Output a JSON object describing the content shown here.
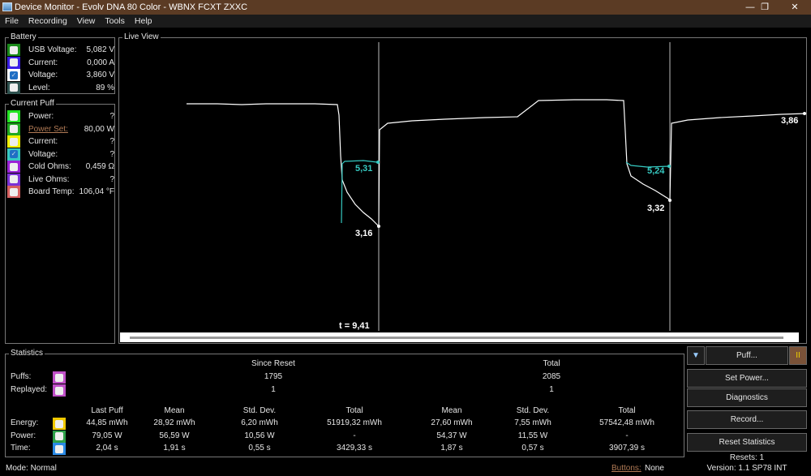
{
  "window": {
    "title": "Device Monitor - Evolv DNA 80 Color - WBNX FCXT ZXXC",
    "minimize": "—",
    "maximize": "❐",
    "close": "✕"
  },
  "menu": [
    "File",
    "Recording",
    "View",
    "Tools",
    "Help"
  ],
  "battery": {
    "label": "Battery",
    "rows": [
      {
        "label": "USB Voltage:",
        "value": "5,082 V",
        "color": "#1a8a1a",
        "checked": false
      },
      {
        "label": "Current:",
        "value": "0,000 A",
        "color": "#3a1ee6",
        "checked": false
      },
      {
        "label": "Voltage:",
        "value": "3,860 V",
        "color": "#ffffff",
        "checked": true
      },
      {
        "label": "Level:",
        "value": "89 %",
        "color": "#2f5350",
        "checked": false
      }
    ]
  },
  "current_puff": {
    "label": "Current Puff",
    "rows": [
      {
        "label": "Power:",
        "value": "?",
        "color": "#22e322",
        "checked": false
      },
      {
        "label": "Power Set:",
        "value": "80,00 W",
        "color": "#1fa81f",
        "checked": false,
        "link": true
      },
      {
        "label": "Current:",
        "value": "?",
        "color": "#f0f000",
        "checked": false
      },
      {
        "label": "Voltage:",
        "value": "?",
        "color": "#36c9c1",
        "checked": true
      },
      {
        "label": "Cold Ohms:",
        "value": "0,459 Ω",
        "color": "#9a22d6",
        "checked": false
      },
      {
        "label": "Live Ohms:",
        "value": "?",
        "color": "#7a32d6",
        "checked": false
      },
      {
        "label": "Board Temp:",
        "value": "106,04 °F",
        "color": "#d66060",
        "checked": false
      }
    ]
  },
  "live_view": {
    "label": "Live View",
    "annotations": {
      "v1": "5,31",
      "v2": "3,16",
      "v3": "5,24",
      "v4": "3,32",
      "v5": "3,86",
      "cursor": "t = 9,41"
    },
    "colors": {
      "voltage": "#ffffff",
      "puff_voltage": "#36c9c1"
    }
  },
  "statistics": {
    "label": "Statistics",
    "since_reset": "Since Reset",
    "total": "Total",
    "puffs": {
      "label": "Puffs:",
      "since_reset": "1795",
      "total": "2085",
      "color": "#c050c8"
    },
    "replayed": {
      "label": "Replayed:",
      "since_reset": "1",
      "total": "1",
      "color": "#c050c8"
    },
    "columns": [
      "Last Puff",
      "Mean",
      "Std. Dev.",
      "Total",
      "Mean",
      "Std. Dev.",
      "Total"
    ],
    "rows": [
      {
        "label": "Energy:",
        "color": "#f0c800",
        "values": [
          "44,85 mWh",
          "28,92 mWh",
          "6,20 mWh",
          "51919,32 mWh",
          "27,60 mWh",
          "7,55 mWh",
          "57542,48 mWh"
        ]
      },
      {
        "label": "Power:",
        "color": "#2fa04a",
        "values": [
          "79,05 W",
          "56,59 W",
          "10,56 W",
          "-",
          "54,37 W",
          "11,55 W",
          "-"
        ]
      },
      {
        "label": "Time:",
        "color": "#2a8ae6",
        "values": [
          "2,04 s",
          "1,91 s",
          "0,55 s",
          "3429,33 s",
          "1,87 s",
          "0,57 s",
          "3907,39 s"
        ]
      }
    ]
  },
  "buttons": {
    "puff": "Puff...",
    "pause": "II",
    "set_power": "Set Power...",
    "diagnostics": "Diagnostics",
    "record": "Record...",
    "reset": "Reset Statistics"
  },
  "status": {
    "mode": "Mode: Normal",
    "buttons_label": "Buttons:",
    "buttons_value": "None",
    "resets": "Resets: 1",
    "version": "Version: 1.1 SP78 INT"
  }
}
